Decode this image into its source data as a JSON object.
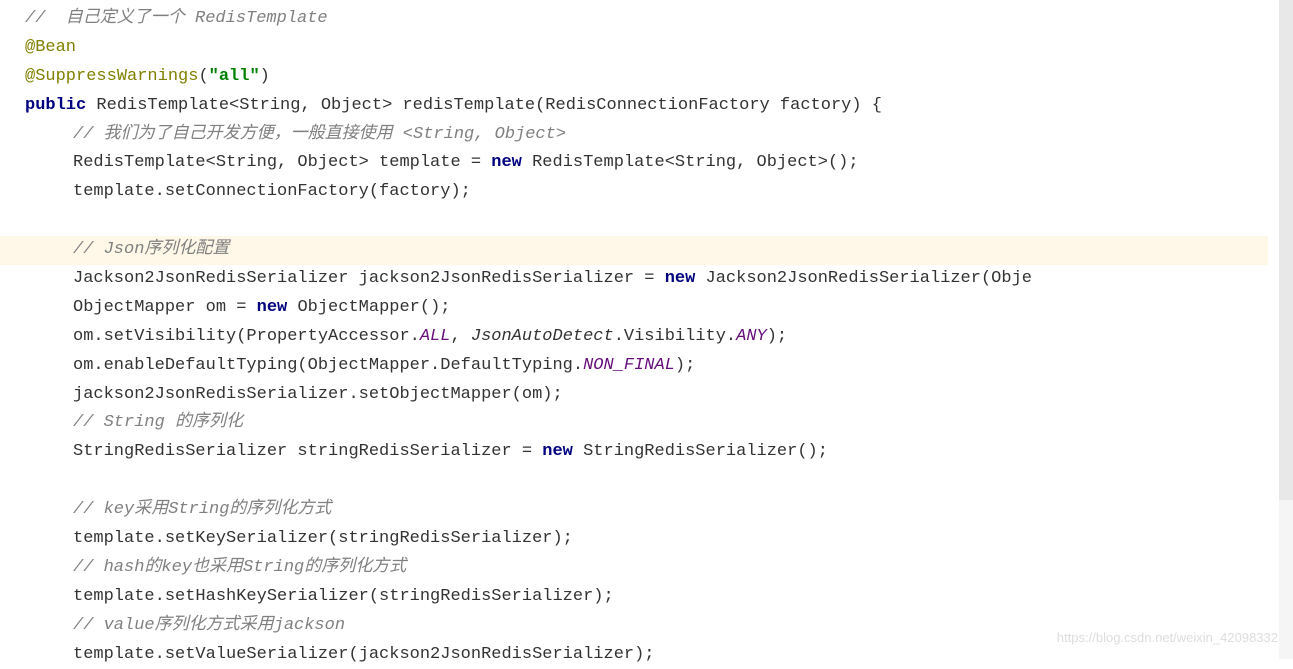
{
  "code": {
    "l1": "//  自己定义了一个 RedisTemplate",
    "l2a": "@Bean",
    "l3a": "@SuppressWarnings",
    "l3b": "(",
    "l3c": "\"all\"",
    "l3d": ")",
    "l4a": "public",
    "l4b": " RedisTemplate<String, Object> redisTemplate(RedisConnectionFactory factory) {",
    "l5": "// 我们为了自己开发方便，一般直接使用 <String, Object>",
    "l6a": "RedisTemplate<String, Object> template = ",
    "l6b": "new",
    "l6c": " RedisTemplate<String, Object>();",
    "l7": "template.setConnectionFactory(factory);",
    "l8a": "// Json",
    "l8b": "序列化配置",
    "l9a": "Jackson2JsonRedisSerializer jackson2JsonRedisSerializer = ",
    "l9b": "new",
    "l9c": " Jackson2JsonRedisSerializer(Obje",
    "l10a": "ObjectMapper om = ",
    "l10b": "new",
    "l10c": " ObjectMapper();",
    "l11a": "om.setVisibility(PropertyAccessor.",
    "l11b": "ALL",
    "l11c": ", ",
    "l11d": "JsonAutoDetect",
    "l11e": ".Visibility.",
    "l11f": "ANY",
    "l11g": ");",
    "l12a": "om.enableDefaultTyping(ObjectMapper.DefaultTyping.",
    "l12b": "NON_FINAL",
    "l12c": ");",
    "l13": "jackson2JsonRedisSerializer.setObjectMapper(om);",
    "l14": "// String 的序列化",
    "l15a": "StringRedisSerializer stringRedisSerializer = ",
    "l15b": "new",
    "l15c": " StringRedisSerializer();",
    "l16": "// key采用String的序列化方式",
    "l17": "template.setKeySerializer(stringRedisSerializer);",
    "l18": "// hash的key也采用String的序列化方式",
    "l19": "template.setHashKeySerializer(stringRedisSerializer);",
    "l20": "// value序列化方式采用jackson",
    "l21": "template.setValueSerializer(jackson2JsonRedisSerializer);"
  },
  "watermark": "https://blog.csdn.net/weixin_42098332"
}
